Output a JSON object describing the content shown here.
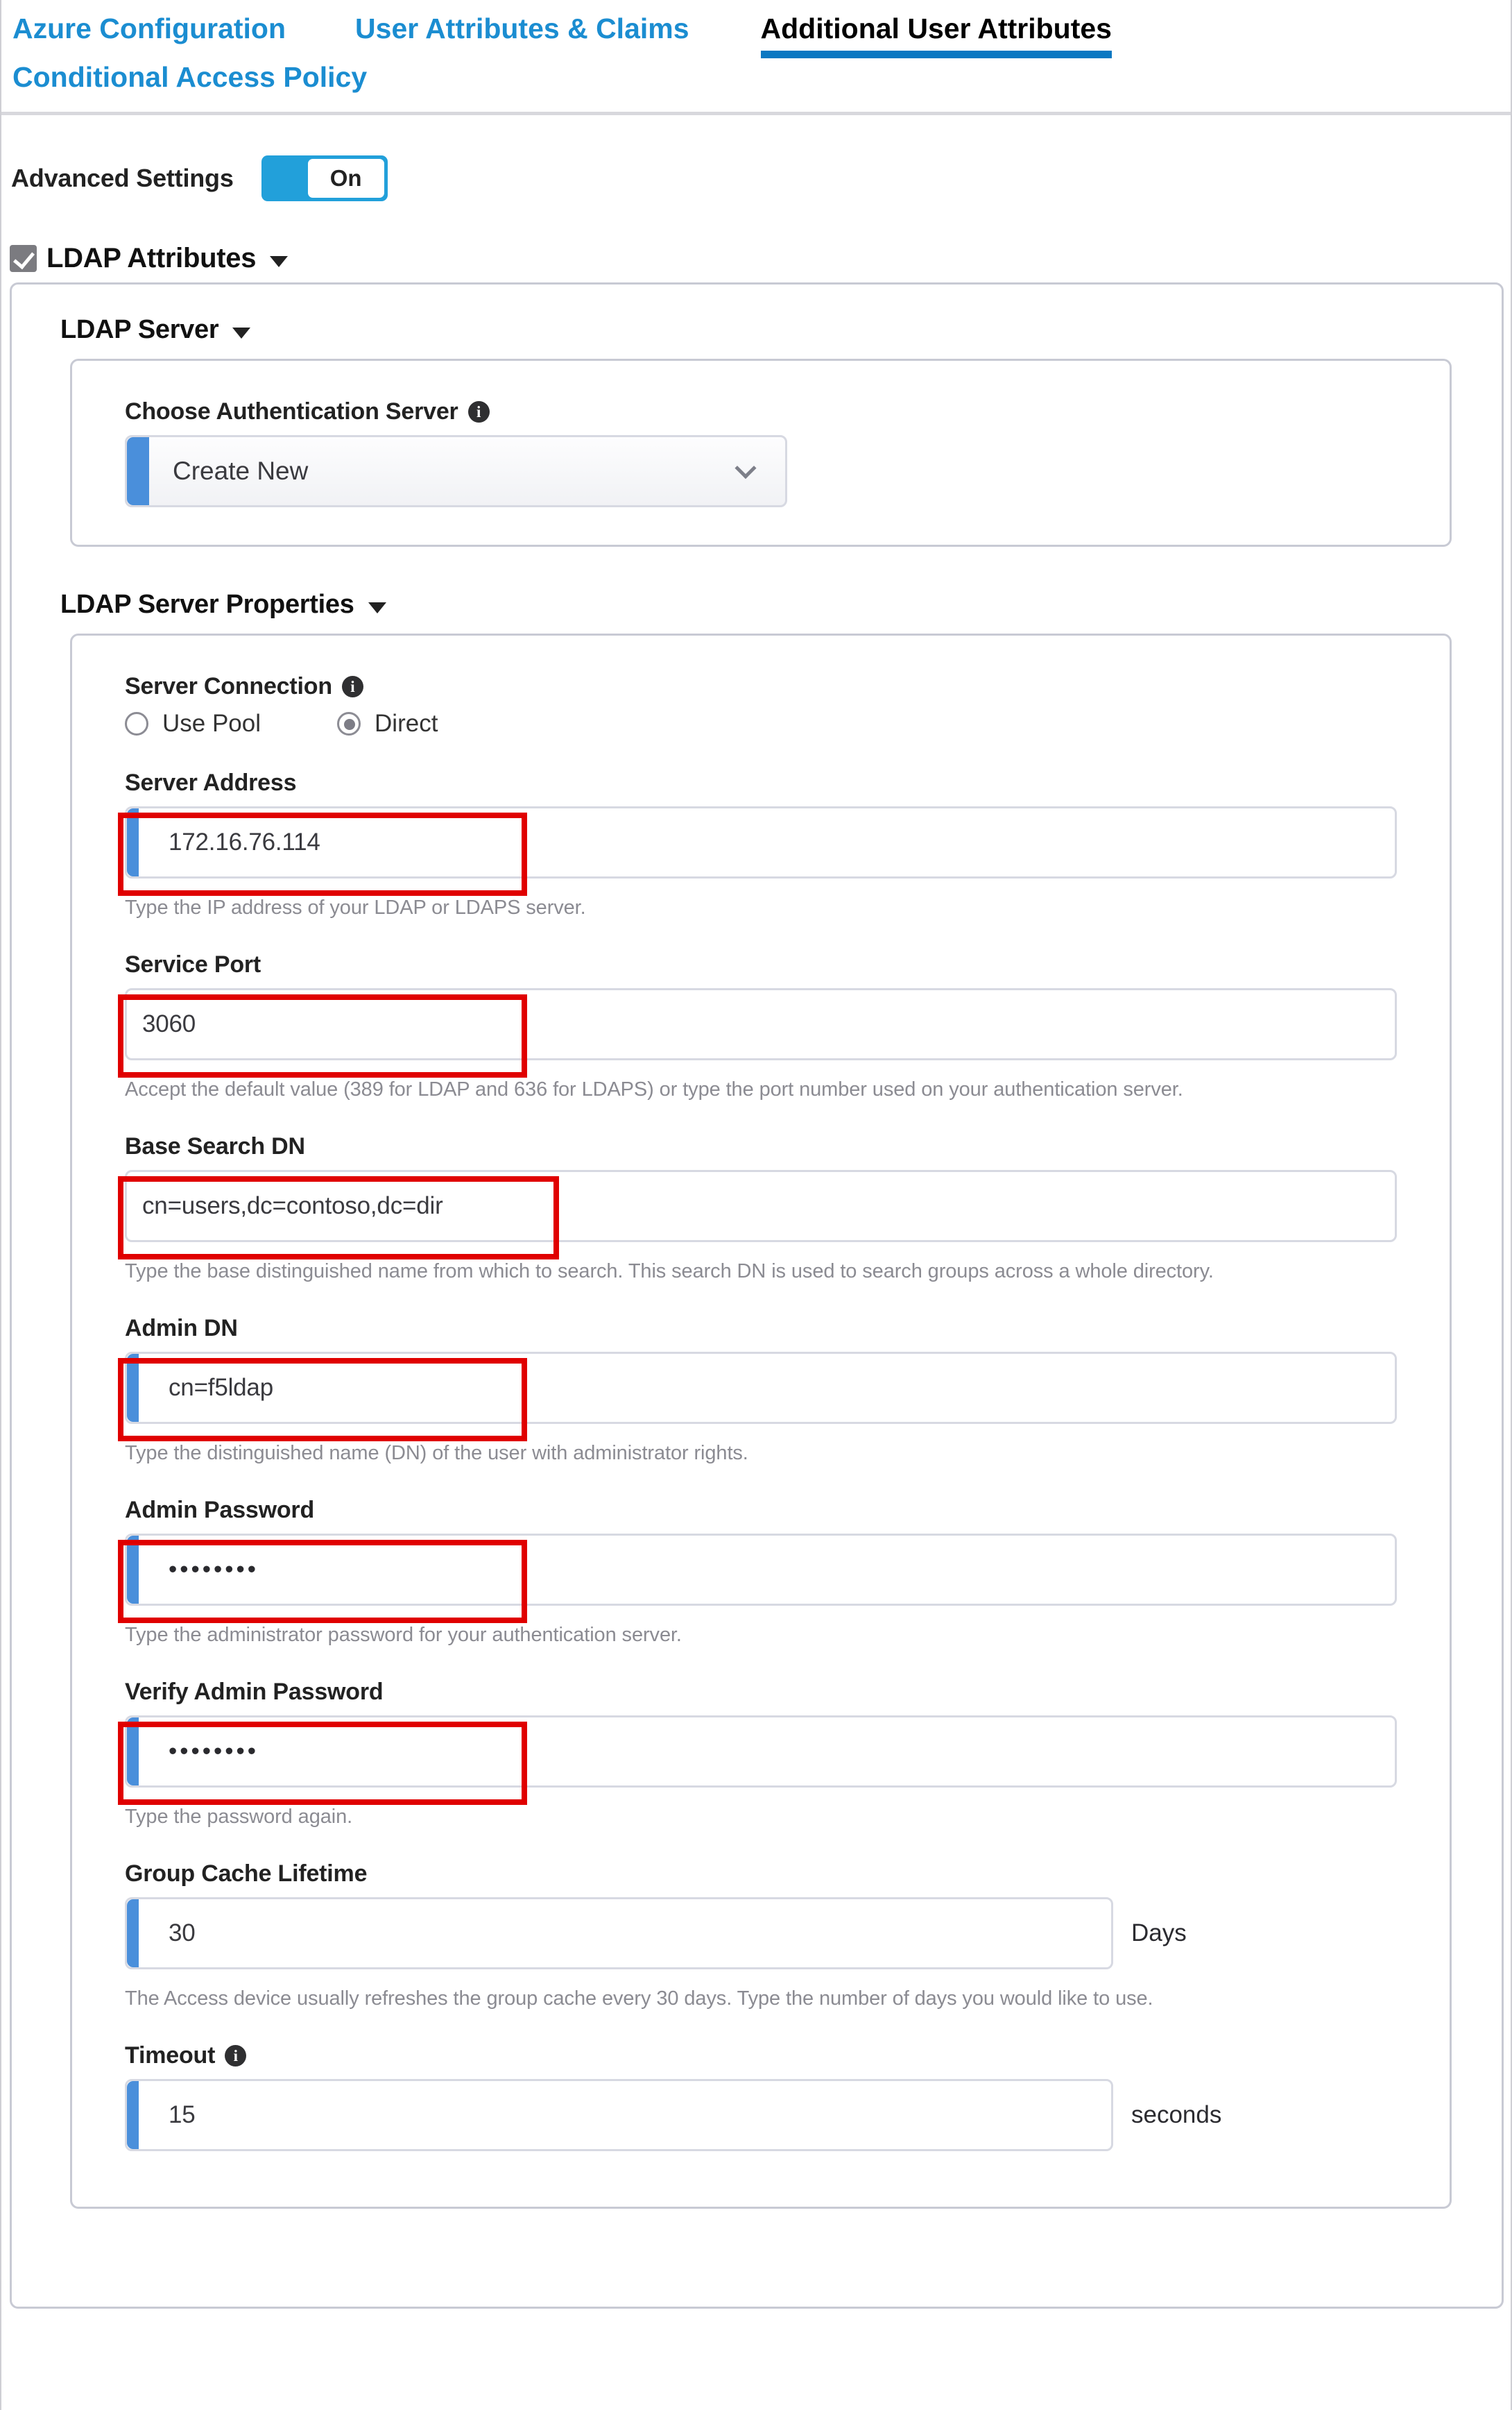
{
  "tabs": [
    {
      "label": "Azure Configuration",
      "active": false
    },
    {
      "label": "User Attributes & Claims",
      "active": false
    },
    {
      "label": "Additional User Attributes",
      "active": true
    },
    {
      "label": "Conditional Access Policy",
      "active": false
    }
  ],
  "advanced": {
    "label": "Advanced Settings",
    "toggle_state": "On"
  },
  "ldap_attributes": {
    "title": "LDAP Attributes",
    "checked": true
  },
  "ldap_server": {
    "title": "LDAP Server",
    "auth_server": {
      "label": "Choose Authentication Server",
      "value": "Create New",
      "info": "info-icon"
    }
  },
  "ldap_server_properties": {
    "title": "LDAP Server Properties",
    "server_connection": {
      "label": "Server Connection",
      "options": [
        {
          "label": "Use Pool",
          "selected": false
        },
        {
          "label": "Direct",
          "selected": true
        }
      ]
    },
    "fields": [
      {
        "label": "Server Address",
        "value": "172.16.76.114",
        "help": "Type the IP address of your LDAP or LDAPS server.",
        "has_blue_bar": true,
        "highlighted": true,
        "unit": "",
        "masked": false
      },
      {
        "label": "Service Port",
        "value": "3060",
        "help": "Accept the default value (389 for LDAP and 636 for LDAPS) or type the port number used on your authentication server.",
        "has_blue_bar": false,
        "highlighted": true,
        "unit": "",
        "masked": false
      },
      {
        "label": "Base Search DN",
        "value": "cn=users,dc=contoso,dc=dir",
        "help": "Type the base distinguished name from which to search. This search DN is used to search groups across a whole directory.",
        "has_blue_bar": false,
        "highlighted": true,
        "unit": "",
        "masked": false
      },
      {
        "label": "Admin DN",
        "value": "cn=f5ldap",
        "help": "Type the distinguished name (DN) of the user with administrator rights.",
        "has_blue_bar": true,
        "highlighted": true,
        "unit": "",
        "masked": false
      },
      {
        "label": "Admin Password",
        "value": "••••••••",
        "help": "Type the administrator password for your authentication server.",
        "has_blue_bar": true,
        "highlighted": true,
        "unit": "",
        "masked": true
      },
      {
        "label": "Verify Admin Password",
        "value": "••••••••",
        "help": "Type the password again.",
        "has_blue_bar": true,
        "highlighted": true,
        "unit": "",
        "masked": true
      },
      {
        "label": "Group Cache Lifetime",
        "value": "30",
        "help": "The Access device usually refreshes the group cache every 30 days. Type the number of days you would like to use.",
        "has_blue_bar": true,
        "highlighted": false,
        "unit": "Days",
        "masked": false
      },
      {
        "label": "Timeout",
        "value": "15",
        "help": "",
        "has_blue_bar": true,
        "highlighted": false,
        "unit": "seconds",
        "masked": false,
        "info": "info-icon"
      }
    ]
  },
  "colors": {
    "tab_link": "#1b8dd1",
    "tab_underline": "#0b78c2",
    "toggle_on": "#22a0da",
    "input_blue_bar": "#4a8fdb",
    "annotation_red": "#e00000",
    "panel_border": "#c8cad4",
    "help_text": "#8b8b92"
  }
}
